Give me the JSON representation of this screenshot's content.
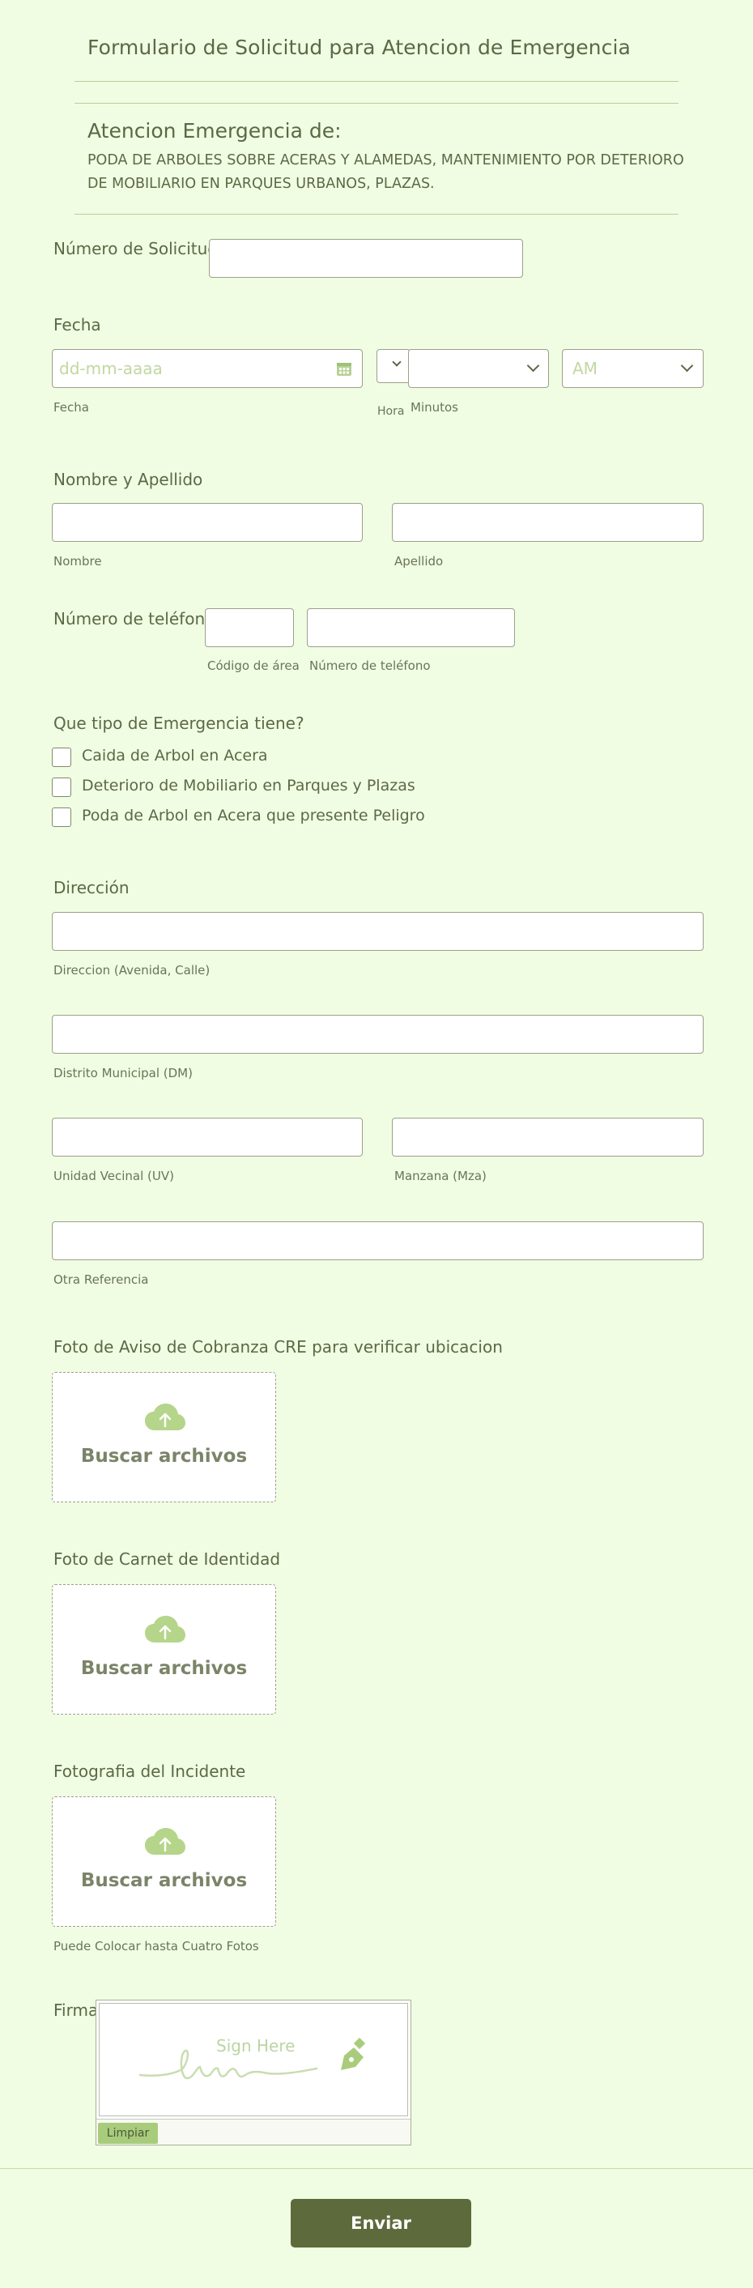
{
  "form": {
    "title": "Formulario de Solicitud para Atencion de Emergencia",
    "section_title": "Atencion Emergencia de:",
    "section_desc_1": "PODA DE ARBOLES SOBRE ACERAS Y ALAMEDAS, MANTENIMIENTO POR DETERIORO",
    "section_desc_2": "DE MOBILIARIO EN PARQUES URBANOS, PLAZAS."
  },
  "solicitud": {
    "label": "Número de Solicitud",
    "value": ""
  },
  "fecha": {
    "label": "Fecha",
    "date_placeholder": "dd-mm-aaaa",
    "date_sublabel": "Fecha",
    "hour_sublabel": "Hora",
    "minutes_sublabel": "Minutos",
    "ampm_value": "AM"
  },
  "nombre": {
    "label": "Nombre y Apellido",
    "first_sublabel": "Nombre",
    "last_sublabel": "Apellido"
  },
  "telefono": {
    "label": "Número de teléfono",
    "area_sublabel": "Código de área",
    "number_sublabel": "Número de teléfono"
  },
  "emergencia": {
    "label": "Que tipo de Emergencia tiene?",
    "options": [
      "Caida de Arbol en Acera",
      "Deterioro de Mobiliario en Parques y Plazas",
      "Poda de Arbol en Acera que presente Peligro"
    ]
  },
  "direccion": {
    "label": "Dirección",
    "street_sublabel": "Direccion (Avenida, Calle)",
    "district_sublabel": "Distrito Municipal (DM)",
    "uv_sublabel": "Unidad Vecinal (UV)",
    "mza_sublabel": "Manzana (Mza)",
    "ref_sublabel": "Otra Referencia"
  },
  "uploads": [
    {
      "label": "Foto de Aviso de Cobranza CRE para verificar ubicacion",
      "button": "Buscar archivos",
      "note": ""
    },
    {
      "label": "Foto de Carnet de Identidad",
      "button": "Buscar archivos",
      "note": ""
    },
    {
      "label": "Fotografia del Incidente",
      "button": "Buscar archivos",
      "note": "Puede Colocar hasta Cuatro Fotos"
    }
  ],
  "firma": {
    "label": "Firma",
    "placeholder": "Sign Here",
    "clear_label": "Limpiar"
  },
  "submit_label": "Enviar",
  "colors": {
    "background": "#f1fde2",
    "accent": "#5d6b3c",
    "light_accent": "#a8cc7c",
    "border": "#9aa18a"
  },
  "icons": {
    "date": "calendar-icon",
    "upload": "cloud-upload-icon",
    "signature": "pen-icon",
    "select": "chevron-down-icon"
  }
}
